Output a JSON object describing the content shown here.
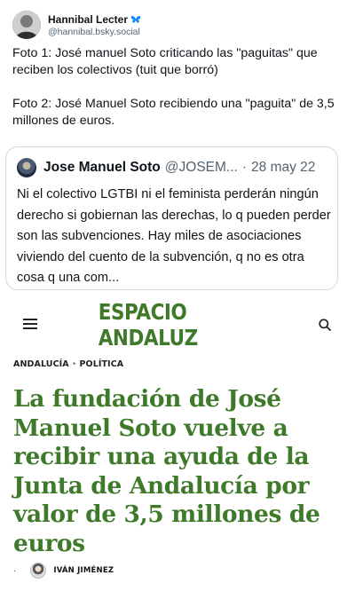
{
  "post": {
    "author_name": "Hannibal Lecter",
    "author_handle": "@hannibal.bsky.social",
    "verified_icon": "butterfly-icon",
    "paragraph_1": "Foto 1: José manuel Soto criticando las \"paguitas\" que reciben los colectivos (tuit que borró)",
    "paragraph_2": "Foto 2: José Manuel Soto recibiendo una \"paguita\" de 3,5 millones de euros."
  },
  "quoted_tweet": {
    "author_name": "Jose Manuel Soto",
    "author_handle": "@JOSEM...",
    "separator": "·",
    "date": "28 may 22",
    "text": "Ni el colectivo LGTBI ni el feminista perderán ningún derecho si gobiernan las derechas, lo q pueden perder son las subvenciones. Hay miles de asociaciones viviendo del cuento de la subvención, q no es otra cosa q una com..."
  },
  "site": {
    "logo": "ESPACIO ANDALUZ",
    "menu_icon": "hamburger-menu-icon",
    "search_icon": "search-icon",
    "accent_color": "#3f7a2a"
  },
  "article": {
    "section_1": "ANDALUCÍA",
    "section_separator": "·",
    "section_2": "POLÍTICA",
    "title": "La fundación de José Manuel Soto vuelve a recibir una ayuda de la Junta de Andalucía por valor de 3,5 millones de euros",
    "byline_dot": "·",
    "author": "IVÁN JIMÉNEZ"
  }
}
